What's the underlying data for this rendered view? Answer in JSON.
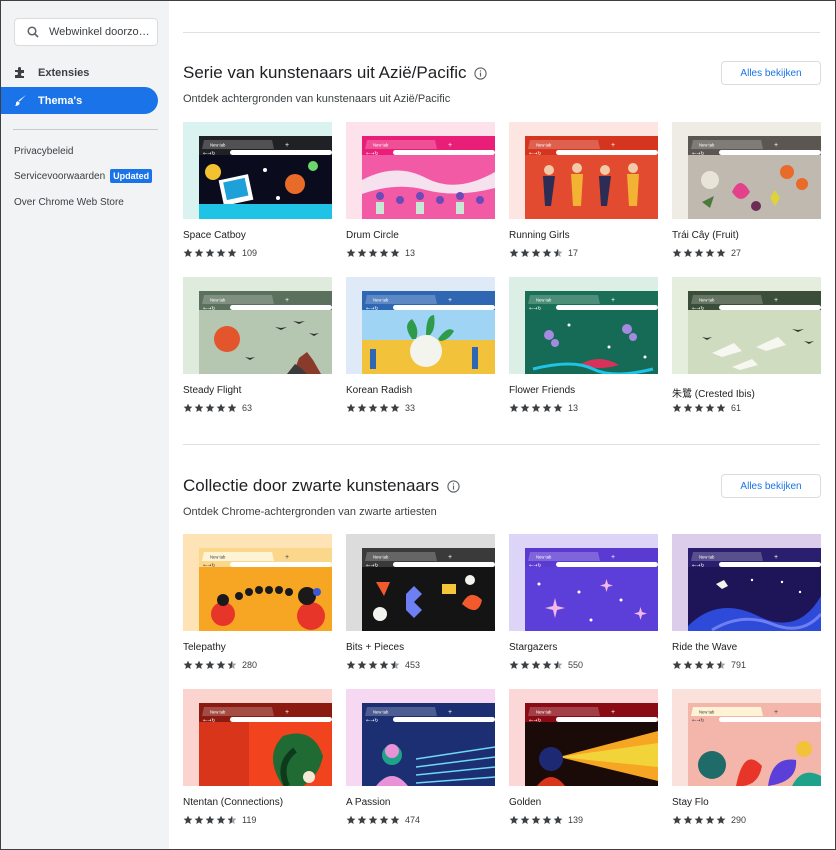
{
  "search": {
    "placeholder": "Webwinkel doorzo…"
  },
  "nav": [
    {
      "label": "Extensies",
      "icon": "puzzle-icon",
      "active": false
    },
    {
      "label": "Thema's",
      "icon": "brush-icon",
      "active": true
    }
  ],
  "footer_links": [
    {
      "label": "Privacybeleid"
    },
    {
      "label": "Servicevoorwaarden",
      "badge": "Updated"
    },
    {
      "label": "Over Chrome Web Store"
    }
  ],
  "colors": {
    "accent": "#1a73e8",
    "sidebar_bg": "#f1f3f4",
    "star": "#3c4043"
  },
  "sections": [
    {
      "title": "Serie van kunstenaars uit Azië/Pacific",
      "subtitle": "Ontdek achtergronden van kunstenaars uit Azië/Pacific",
      "see_all": "Alles bekijken",
      "themes": [
        {
          "name": "Space Catboy",
          "rating": 5,
          "count": "109",
          "tab": "New tab",
          "bg": "#daf3f0",
          "frame": "#202124",
          "art": "space"
        },
        {
          "name": "Drum Circle",
          "rating": 5,
          "count": "13",
          "tab": "New tab",
          "bg": "#fde2ec",
          "frame": "#e91e78",
          "art": "drum"
        },
        {
          "name": "Running Girls",
          "rating": 4.5,
          "count": "17",
          "tab": "New tab",
          "bg": "#fde6e2",
          "frame": "#d5351f",
          "art": "running"
        },
        {
          "name": "Trái Cây (Fruit)",
          "rating": 5,
          "count": "27",
          "tab": "New tab",
          "bg": "#efece6",
          "frame": "#5b5651",
          "art": "fruit"
        },
        {
          "name": "Steady Flight",
          "rating": 5,
          "count": "63",
          "tab": "New tab",
          "bg": "#dfecdd",
          "frame": "#5b705d",
          "art": "flight"
        },
        {
          "name": "Korean Radish",
          "rating": 5,
          "count": "33",
          "tab": "New tab",
          "bg": "#deeaf7",
          "frame": "#2f67b2",
          "art": "radish"
        },
        {
          "name": "Flower Friends",
          "rating": 5,
          "count": "13",
          "tab": "New tab",
          "bg": "#dcefe7",
          "frame": "#1c6f57",
          "art": "flower"
        },
        {
          "name": "朱鷺 (Crested Ibis)",
          "rating": 5,
          "count": "61",
          "tab": "New tab",
          "bg": "#e5eddd",
          "frame": "#3b4e39",
          "art": "ibis"
        }
      ]
    },
    {
      "title": "Collectie door zwarte kunstenaars",
      "subtitle": "Ontdek Chrome-achtergronden van zwarte artiesten",
      "see_all": "Alles bekijken",
      "themes": [
        {
          "name": "Telepathy",
          "rating": 4.5,
          "count": "280",
          "tab": "New tab",
          "bg": "#fde3b6",
          "frame": "#fbd78c",
          "art": "telepathy"
        },
        {
          "name": "Bits + Pieces",
          "rating": 4.5,
          "count": "453",
          "tab": "New tab",
          "bg": "#dcdcdc",
          "frame": "#3a3a3a",
          "art": "bits"
        },
        {
          "name": "Stargazers",
          "rating": 4.5,
          "count": "550",
          "tab": "New tab",
          "bg": "#ddd5f8",
          "frame": "#5a3ad0",
          "art": "stars"
        },
        {
          "name": "Ride the Wave",
          "rating": 4.5,
          "count": "791",
          "tab": "New tab",
          "bg": "#dccdea",
          "frame": "#2a1e6e",
          "art": "wave"
        },
        {
          "name": "Ntentan (Connections)",
          "rating": 4.5,
          "count": "119",
          "tab": "New tab",
          "bg": "#fbd3cf",
          "frame": "#8b1b10",
          "art": "ntentan"
        },
        {
          "name": "A Passion",
          "rating": 5,
          "count": "474",
          "tab": "New tab",
          "bg": "#f7d8f2",
          "frame": "#1c2f73",
          "art": "passion"
        },
        {
          "name": "Golden",
          "rating": 5,
          "count": "139",
          "tab": "New tab",
          "bg": "#fbd7d7",
          "frame": "#8a0b14",
          "art": "golden"
        },
        {
          "name": "Stay Flo",
          "rating": 5,
          "count": "290",
          "tab": "New tab",
          "bg": "#fbe1dc",
          "frame": "#f4b5ab",
          "art": "stayflo"
        }
      ]
    }
  ]
}
